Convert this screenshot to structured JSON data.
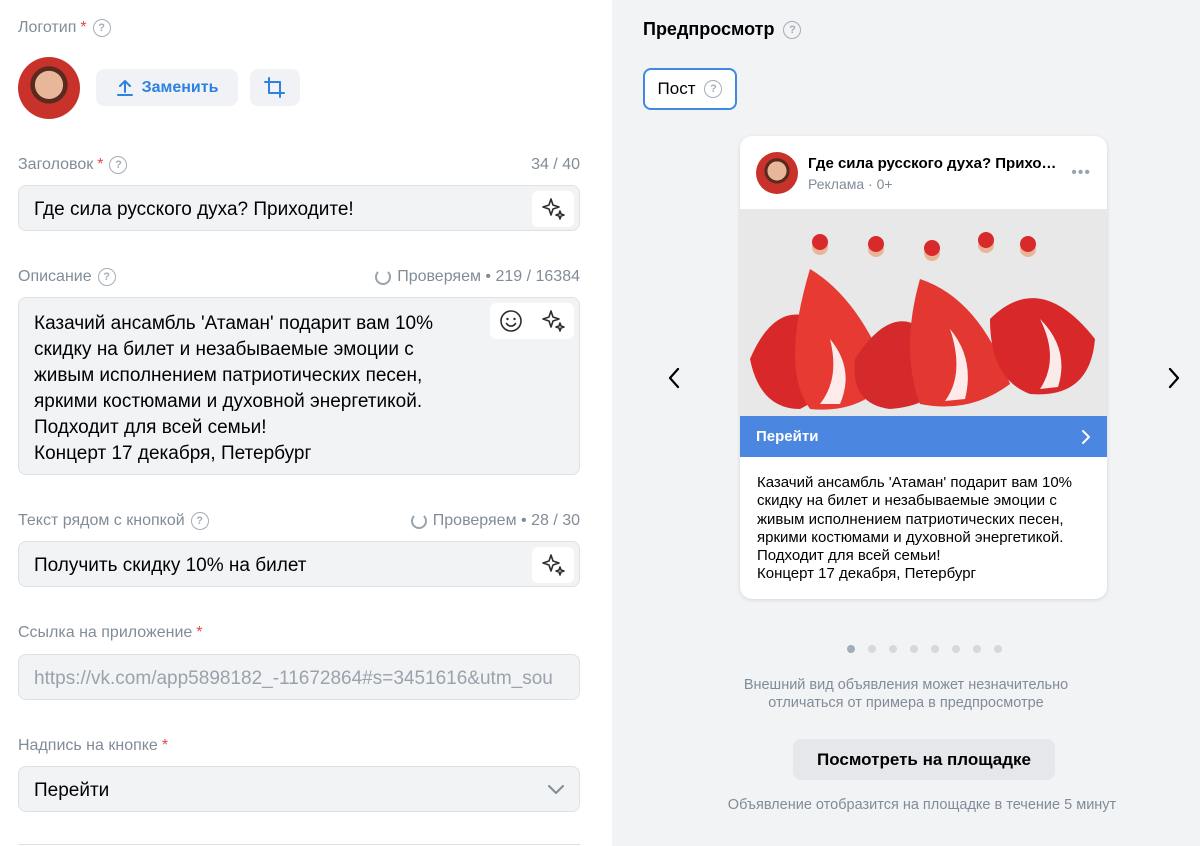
{
  "logo": {
    "label": "Логотип",
    "required_mark": "*",
    "replace_label": "Заменить"
  },
  "headline": {
    "label": "Заголовок",
    "required_mark": "*",
    "counter": "34 / 40",
    "value": "Где сила русского духа? Приходите!"
  },
  "description": {
    "label": "Описание",
    "status": "Проверяем • 219 / 16384",
    "value": "Казачий ансамбль 'Атаман' подарит вам 10%\nскидку на билет и незабываемые эмоции с\nживым исполнением патриотических песен,\nяркими костюмами и духовной энергетикой.\nПодходит для всей семьи!\nКонцерт 17 декабря, Петербург"
  },
  "button_text": {
    "label": "Текст рядом с кнопкой",
    "status": "Проверяем • 28 / 30",
    "value": "Получить скидку 10% на билет"
  },
  "app_link": {
    "label": "Ссылка на приложение",
    "required_mark": "*",
    "value": "https://vk.com/app5898182_-11672864#s=3451616&utm_sou"
  },
  "button_caption": {
    "label": "Надпись на кнопке",
    "required_mark": "*",
    "value": "Перейти"
  },
  "preview": {
    "title": "Предпросмотр",
    "tab": "Пост",
    "card": {
      "title": "Где сила русского духа? Приходите!",
      "subtitle": "Реклама · 0+",
      "cta": "Перейти",
      "description": "Казачий ансамбль 'Атаман' подарит вам 10%\nскидку на билет и незабываемые эмоции с\nживым исполнением патриотических песен,\nяркими костюмами и духовной энергетикой.\nПодходит для всей семьи!\nКонцерт 17 декабря, Петербург"
    },
    "dots": {
      "total": 8,
      "active": 1
    },
    "note": "Внешний вид объявления может незначительно отличаться от примера в предпросмотре",
    "view_button": "Посмотреть на площадке",
    "footer": "Объявление отобразится на площадке в течение 5 минут"
  },
  "colors": {
    "accent": "#2d81e0",
    "required": "#e64646",
    "cta": "#4b86e0",
    "field_bg": "#f2f3f5"
  }
}
